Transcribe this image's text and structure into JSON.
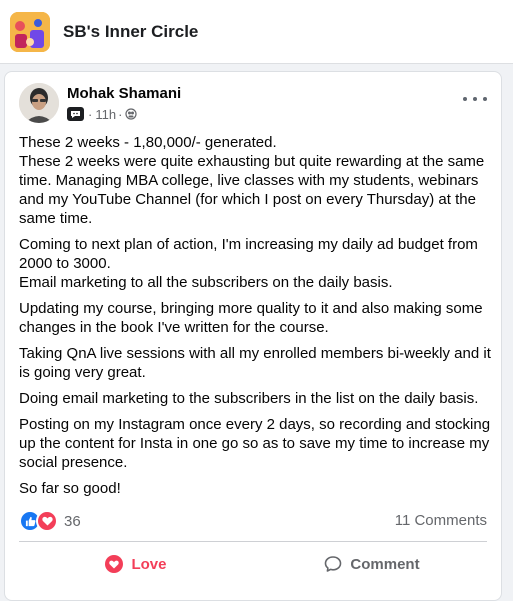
{
  "group": {
    "name": "SB's Inner Circle"
  },
  "post": {
    "author": "Mohak Shamani",
    "time": "11h",
    "separator": "·",
    "paragraphs": [
      "These 2 weeks - 1,80,000/- generated.\nThese 2 weeks were quite exhausting but quite rewarding at the same time. Managing MBA college, live classes with my students, webinars and my YouTube Channel (for which I post on every Thursday) at the same time.",
      "Coming to next plan of action, I'm increasing my daily ad budget from 2000 to 3000.\nEmail marketing to all the subscribers on the daily basis.",
      "Updating my course, bringing more quality to it and also making some changes in the book I've written for the course.",
      "Taking QnA live sessions with all my enrolled members bi-weekly and it is going very great.",
      "Doing email marketing to the subscribers in the list on the daily basis.",
      "Posting on my Instagram once every 2 days, so recording and stocking up the content for Insta in one go so as to save my time to increase my social presence.",
      "So far so good!"
    ],
    "reactions_count": "36",
    "comments_count": "11 Comments"
  },
  "actions": {
    "love_label": "Love",
    "comment_label": "Comment"
  },
  "icons": {
    "privacy": "globe-icon",
    "badge": "conversation-starter-icon",
    "more": "more-icon",
    "like": "like-reaction-icon",
    "love": "love-reaction-icon",
    "comment": "comment-icon"
  },
  "colors": {
    "like_blue": "#1877f2",
    "love_red": "#f33e58",
    "muted": "#65676b"
  }
}
